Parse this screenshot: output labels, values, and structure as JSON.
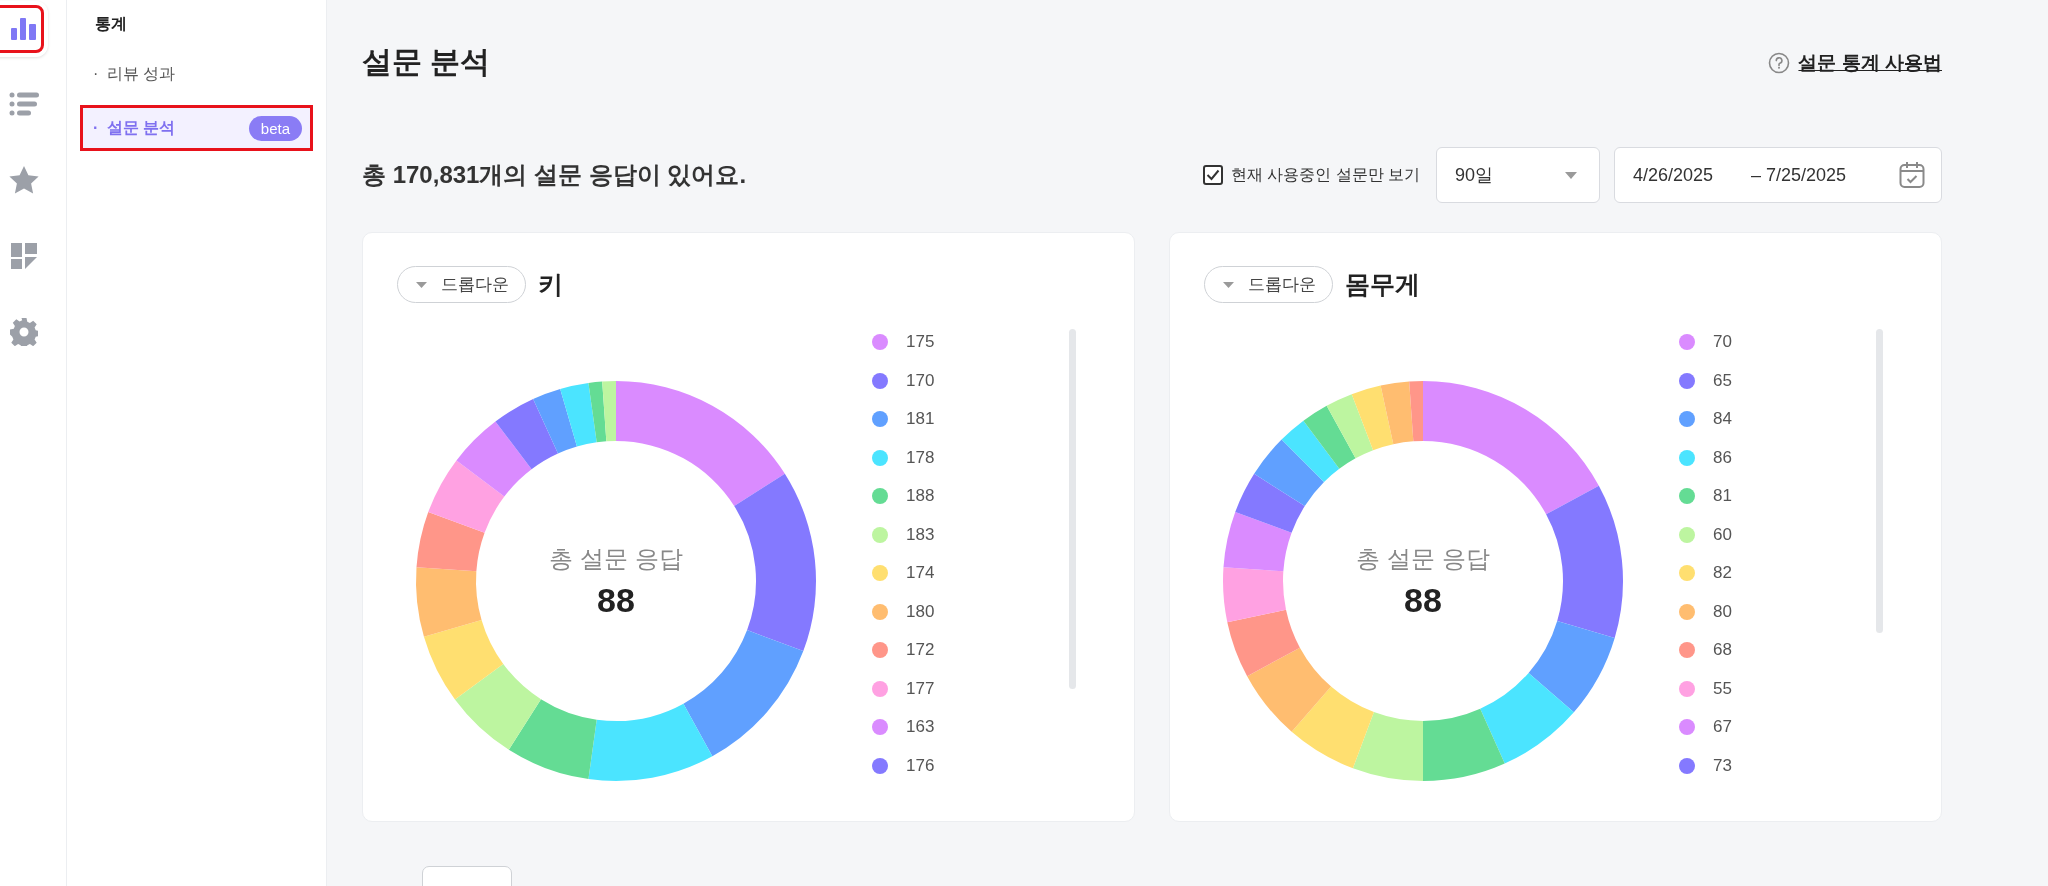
{
  "rail": [
    {
      "kind": "chart",
      "selected": true,
      "highlighted": true
    },
    {
      "kind": "list",
      "selected": false,
      "highlighted": false
    },
    {
      "kind": "star",
      "selected": false,
      "highlighted": false
    },
    {
      "kind": "grid",
      "selected": false,
      "highlighted": false
    },
    {
      "kind": "gear",
      "selected": false,
      "highlighted": false
    }
  ],
  "sidebar": {
    "heading": "통계",
    "items": [
      {
        "marker": "·",
        "label": "리뷰 성과",
        "selected": false,
        "highlighted": false
      },
      {
        "marker": "·",
        "label": "설문 분석",
        "badge": "beta",
        "selected": true,
        "highlighted": true
      }
    ]
  },
  "page_title": "설문 분석",
  "help_link": "설문 통계 사용법",
  "summary": "총 170,831개의 설문 응답이 있어요.",
  "filter": {
    "label": "현재 사용중인 설문만 보기",
    "checked": true
  },
  "period": "90일",
  "date_range": {
    "start": "4/26/2025",
    "separator": "–",
    "end": "7/25/2025"
  },
  "cards": [
    {
      "dropdown": "드롭다운",
      "title": "키",
      "center_label": "총 설문 응답",
      "center_value": "88",
      "legend": [
        {
          "label": "175",
          "color": "#da8bff"
        },
        {
          "label": "170",
          "color": "#8479ff"
        },
        {
          "label": "181",
          "color": "#60a0ff"
        },
        {
          "label": "178",
          "color": "#4be4ff"
        },
        {
          "label": "188",
          "color": "#64dc94"
        },
        {
          "label": "183",
          "color": "#bdf5a0"
        },
        {
          "label": "174",
          "color": "#ffdf70"
        },
        {
          "label": "180",
          "color": "#ffbd70"
        },
        {
          "label": "172",
          "color": "#ff9689"
        },
        {
          "label": "177",
          "color": "#ffa1e2"
        },
        {
          "label": "163",
          "color": "#da8bff"
        },
        {
          "label": "176",
          "color": "#8479ff"
        }
      ]
    },
    {
      "dropdown": "드롭다운",
      "title": "몸무게",
      "center_label": "총 설문 응답",
      "center_value": "88",
      "legend": [
        {
          "label": "70",
          "color": "#da8bff"
        },
        {
          "label": "65",
          "color": "#8479ff"
        },
        {
          "label": "84",
          "color": "#60a0ff"
        },
        {
          "label": "86",
          "color": "#4be4ff"
        },
        {
          "label": "81",
          "color": "#64dc94"
        },
        {
          "label": "60",
          "color": "#bdf5a0"
        },
        {
          "label": "82",
          "color": "#ffdf70"
        },
        {
          "label": "80",
          "color": "#ffbd70"
        },
        {
          "label": "68",
          "color": "#ff9689"
        },
        {
          "label": "55",
          "color": "#ffa1e2"
        },
        {
          "label": "67",
          "color": "#da8bff"
        },
        {
          "label": "73",
          "color": "#8479ff"
        }
      ]
    }
  ]
}
